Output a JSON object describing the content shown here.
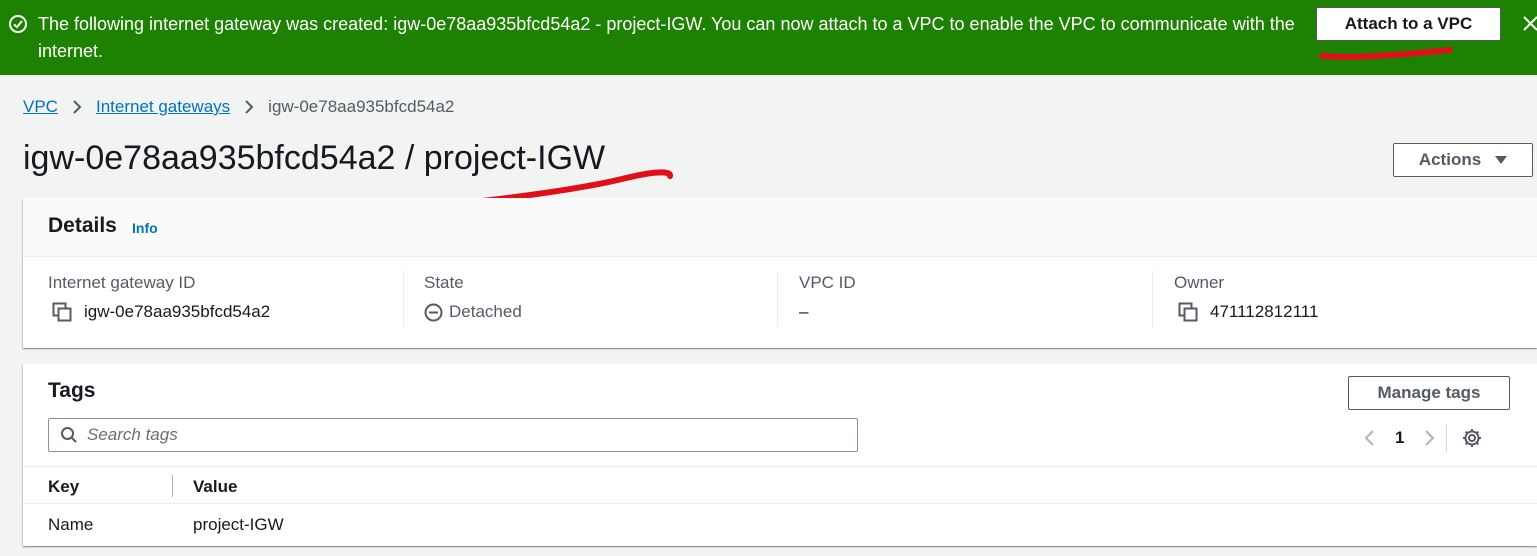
{
  "flash": {
    "message": "The following internet gateway was created: igw-0e78aa935bfcd54a2 - project-IGW. You can now attach to a VPC to enable the VPC to communicate with the internet.",
    "attach_button": "Attach to a VPC",
    "color": "#1d8102"
  },
  "breadcrumb": {
    "root": "VPC",
    "parent": "Internet gateways",
    "current": "igw-0e78aa935bfcd54a2"
  },
  "page_title": "igw-0e78aa935bfcd54a2 / project-IGW",
  "actions_button": "Actions",
  "details": {
    "title": "Details",
    "info_link": "Info",
    "fields": [
      {
        "label": "Internet gateway ID",
        "value": "igw-0e78aa935bfcd54a2",
        "icon": "copy-icon"
      },
      {
        "label": "State",
        "value": "Detached",
        "icon": "detached-status-icon"
      },
      {
        "label": "VPC ID",
        "value": "–"
      },
      {
        "label": "Owner",
        "value": "471112812111",
        "icon": "copy-icon"
      }
    ]
  },
  "tags": {
    "title": "Tags",
    "manage_button": "Manage tags",
    "search_placeholder": "Search tags",
    "page": "1",
    "columns": {
      "key": "Key",
      "value": "Value"
    },
    "rows": [
      {
        "key": "Name",
        "value": "project-IGW"
      }
    ]
  },
  "colors": {
    "link": "#0073bb",
    "annotation": "#e0101a"
  }
}
